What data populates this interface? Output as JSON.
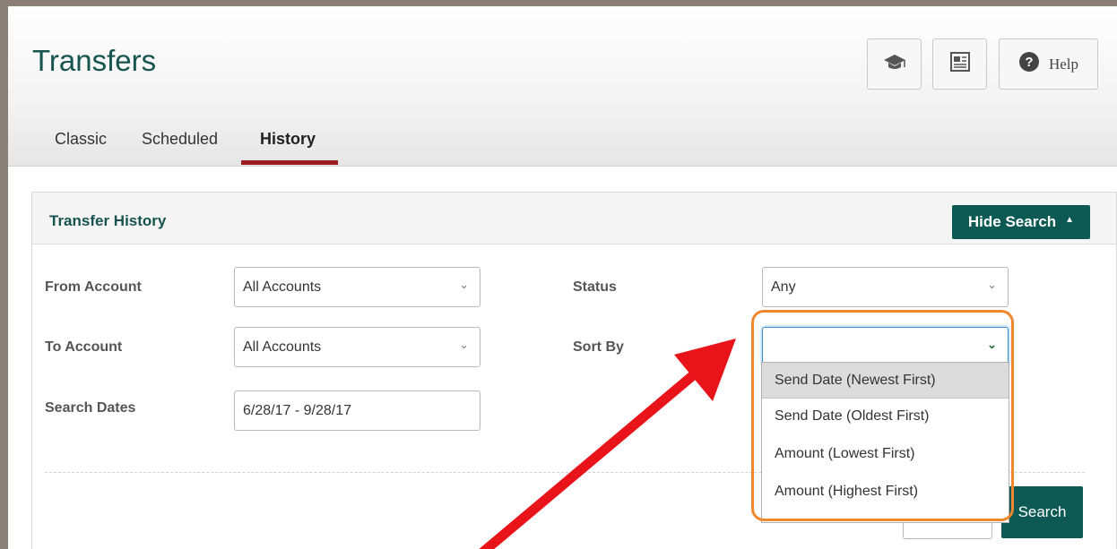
{
  "header": {
    "title": "Transfers",
    "help_label": "Help",
    "icons": [
      "graduation-cap-icon",
      "newspaper-icon",
      "question-circle-icon"
    ]
  },
  "tabs": [
    {
      "label": "Classic",
      "active": false
    },
    {
      "label": "Scheduled",
      "active": false
    },
    {
      "label": "History",
      "active": true
    }
  ],
  "panel": {
    "title": "Transfer History",
    "hide_search_label": "Hide Search",
    "search_label": "Search"
  },
  "form": {
    "from_account": {
      "label": "From Account",
      "value": "All Accounts"
    },
    "to_account": {
      "label": "To Account",
      "value": "All Accounts"
    },
    "search_dates": {
      "label": "Search Dates",
      "value": "6/28/17 - 9/28/17"
    },
    "status": {
      "label": "Status",
      "value": "Any"
    },
    "sort_by": {
      "label": "Sort By",
      "value": "",
      "options": [
        "Send Date (Newest First)",
        "Send Date (Oldest First)",
        "Amount (Lowest First)",
        "Amount (Highest First)"
      ],
      "highlighted_index": 0
    }
  },
  "colors": {
    "brand": "#0c5a53",
    "active_tab_underline": "#9e1b1f",
    "annotation_box": "#f0862e",
    "annotation_arrow": "#e8141a"
  }
}
